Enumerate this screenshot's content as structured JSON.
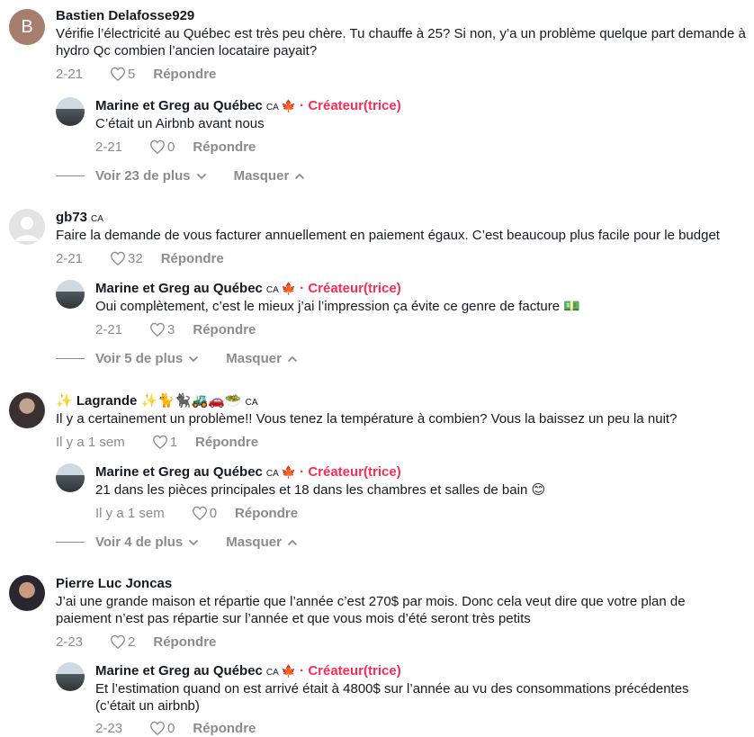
{
  "comments": [
    {
      "author": "Bastien Delafosse929",
      "avatar_letter": "B",
      "country": "",
      "text": "Vérifie l’électricité au Québec est très peu chère. Tu chauffe à 25? Si non, y’a un problème quelque part demande à hydro Qc combien l’ancien locataire payait?",
      "date": "2-21",
      "likes": "5",
      "reply_label": "Répondre",
      "reply": {
        "author": "Marine et Greg au Québec",
        "country": "CA",
        "leaf": "🍁",
        "creator": "· Créateur(trice)",
        "text": "C’était un Airbnb avant nous",
        "date": "2-21",
        "likes": "0",
        "reply_label": "Répondre"
      },
      "more_label": "Voir 23 de plus",
      "hide_label": "Masquer"
    },
    {
      "author": "gb73",
      "country": "CA",
      "text": "Faire la demande de vous facturer annuellement en paiement égaux. C’est beaucoup plus facile pour le budget",
      "date": "2-21",
      "likes": "32",
      "reply_label": "Répondre",
      "reply": {
        "author": "Marine et Greg au Québec",
        "country": "CA",
        "leaf": "🍁",
        "creator": "· Créateur(trice)",
        "text": "Oui complètement, c’est le mieux j’ai l’impression ça évite ce genre de facture 💵",
        "date": "2-21",
        "likes": "3",
        "reply_label": "Répondre"
      },
      "more_label": "Voir 5 de plus",
      "hide_label": "Masquer"
    },
    {
      "author": "✨ Lagrande ✨🐈🐈‍⬛🚜🚗🥗",
      "country": "CA",
      "text": "Il y a certainement un problème!! Vous tenez la température à combien? Vous la baissez un peu la nuit?",
      "date": "Il y a 1 sem",
      "likes": "1",
      "reply_label": "Répondre",
      "reply": {
        "author": "Marine et Greg au Québec",
        "country": "CA",
        "leaf": "🍁",
        "creator": "· Créateur(trice)",
        "text": "21 dans les pièces principales et 18 dans les chambres et salles de bain 😊",
        "date": "Il y a 1 sem",
        "likes": "0",
        "reply_label": "Répondre"
      },
      "more_label": "Voir 4 de plus",
      "hide_label": "Masquer"
    },
    {
      "author": "Pierre Luc Joncas",
      "country": "",
      "text": "J’ai une grande maison et répartie que l’année c’est 270$ par mois. Donc cela veut dire que votre plan de paiement n’est pas répartie sur l’année et que vous mois d’été seront très petits",
      "date": "2-23",
      "likes": "2",
      "reply_label": "Répondre",
      "reply": {
        "author": "Marine et Greg au Québec",
        "country": "CA",
        "leaf": "🍁",
        "creator": "· Créateur(trice)",
        "text": "Et l’estimation quand on est arrivé était à 4800$ sur l’année au vu des consommations précédentes (c’était un airbnb)",
        "date": "2-23",
        "likes": "0",
        "reply_label": "Répondre"
      }
    }
  ]
}
